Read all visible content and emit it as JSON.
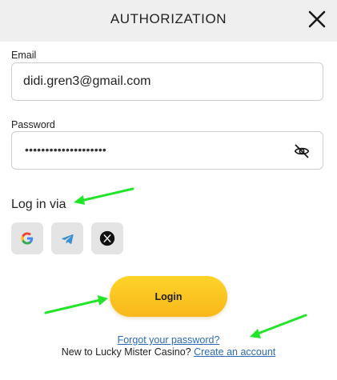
{
  "header": {
    "title": "AUTHORIZATION",
    "close_icon": "close-icon"
  },
  "email": {
    "label": "Email",
    "value": "didi.gren3@gmail.com"
  },
  "password": {
    "label": "Password",
    "masked_value": "••••••••••••••••••••",
    "toggle_icon": "eye-slash-icon"
  },
  "login_via": {
    "label": "Log in via",
    "providers": [
      "google-icon",
      "telegram-icon",
      "x-icon"
    ]
  },
  "login_button": {
    "label": "Login"
  },
  "forgot_link": "Forgot your password?",
  "signup": {
    "text": "New to Lucky Mister Casino?",
    "link": "Create an account"
  },
  "colors": {
    "accent": "#fcc722",
    "link": "#2d6bb8",
    "annotation_arrow": "#22e52a",
    "header_bg": "#efefef"
  }
}
